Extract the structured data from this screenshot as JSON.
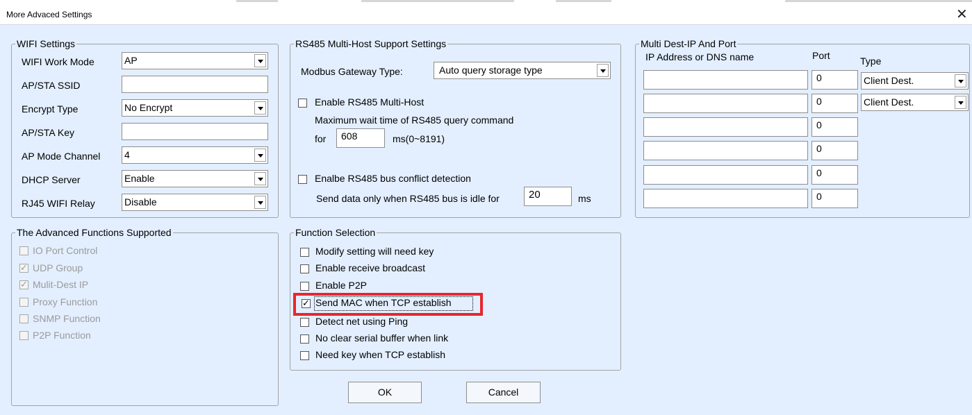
{
  "window": {
    "title": "More Advaced Settings",
    "close_glyph": "✕"
  },
  "wifi": {
    "legend": "WIFI Settings",
    "rows": [
      {
        "label": "WIFI Work Mode",
        "value": "AP",
        "type": "select"
      },
      {
        "label": "AP/STA SSID",
        "value": "",
        "type": "input"
      },
      {
        "label": "Encrypt Type",
        "value": "No Encrypt",
        "type": "select"
      },
      {
        "label": "AP/STA Key",
        "value": "",
        "type": "input"
      },
      {
        "label": "AP Mode Channel",
        "value": "4",
        "type": "select"
      },
      {
        "label": "DHCP Server",
        "value": "Enable",
        "type": "select"
      },
      {
        "label": "RJ45 WIFI Relay",
        "value": "Disable",
        "type": "select"
      }
    ]
  },
  "advanced": {
    "legend": "The Advanced Functions Supported",
    "items": [
      {
        "label": "IO Port Control",
        "checked": false
      },
      {
        "label": "UDP Group",
        "checked": true
      },
      {
        "label": "Mulit-Dest IP",
        "checked": true
      },
      {
        "label": "Proxy Function",
        "checked": false
      },
      {
        "label": "SNMP Function",
        "checked": false
      },
      {
        "label": "P2P Function",
        "checked": false
      }
    ]
  },
  "rs485": {
    "legend": "RS485 Multi-Host Support Settings",
    "gateway_label": "Modbus Gateway Type:",
    "gateway_value": "Auto query storage type",
    "multihost_label": "Enable RS485 Multi-Host",
    "multihost_checked": false,
    "wait_text": "Maximum wait time of RS485  query command",
    "for_label": "for",
    "wait_value": "608",
    "wait_unit": "ms(0~8191)",
    "conflict_label": "Enalbe RS485 bus conflict detection",
    "conflict_checked": false,
    "idle_text": "Send data only when RS485 bus is idle for",
    "idle_value": "20",
    "idle_unit": "ms"
  },
  "function_selection": {
    "legend": "Function Selection",
    "items": [
      {
        "label": "Modify setting will need key",
        "checked": false
      },
      {
        "label": "Enable receive broadcast",
        "checked": false
      },
      {
        "label": "Enable P2P",
        "checked": false
      },
      {
        "label": "Send MAC when TCP establish",
        "checked": true
      },
      {
        "label": "Detect net using Ping",
        "checked": false
      },
      {
        "label": "No clear serial buffer when link",
        "checked": false
      },
      {
        "label": "Need key when TCP establish",
        "checked": false
      }
    ]
  },
  "multi_dest": {
    "legend": "Multi Dest-IP And Port",
    "headers": {
      "ip": "IP Address or DNS name",
      "port": "Port",
      "type": "Type"
    },
    "rows": [
      {
        "ip": "",
        "port": "0",
        "type": "Client Dest."
      },
      {
        "ip": "",
        "port": "0",
        "type": "Client Dest."
      },
      {
        "ip": "",
        "port": "0"
      },
      {
        "ip": "",
        "port": "0"
      },
      {
        "ip": "",
        "port": "0"
      },
      {
        "ip": "",
        "port": "0"
      }
    ]
  },
  "buttons": {
    "ok": "OK",
    "cancel": "Cancel"
  },
  "colors": {
    "background": "#e3efff",
    "highlight": "#e8262e"
  },
  "check_glyph": "✓"
}
